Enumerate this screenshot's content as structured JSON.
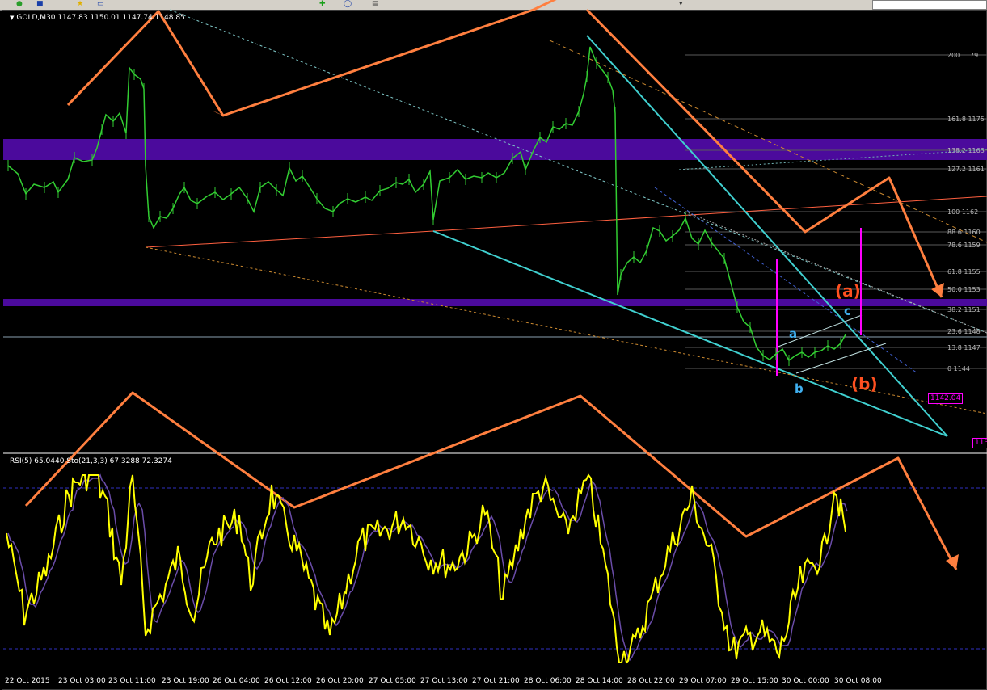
{
  "symbol_info": "GOLD,M30 1147.83 1150.01 1147.74 1148.85",
  "indicator_info": "RSI(5) 65.0440 Sto(21,3,3) 67.3288 72.3274",
  "price_tags": [
    "1142.04",
    "113"
  ],
  "fib_levels": [
    "200 1179",
    "161.8 1175",
    "138.2 1163",
    "127.2 1161",
    "100 1162",
    "88.6 1160",
    "78.6 1159",
    "61.8 1155",
    "50.0 1153",
    "38.2 1151",
    "23.6 1148",
    "13.8 1147",
    "0 1144"
  ],
  "wave_labels": {
    "a_big": "(a)",
    "b_big": "(b)",
    "a": "a",
    "b": "b",
    "c": "c"
  },
  "time_axis": [
    "22 Oct 2015",
    "23 Oct 03:00",
    "23 Oct 11:00",
    "23 Oct 19:00",
    "26 Oct 04:00",
    "26 Oct 12:00",
    "26 Oct 20:00",
    "27 Oct 05:00",
    "27 Oct 13:00",
    "27 Oct 21:00",
    "28 Oct 06:00",
    "28 Oct 14:00",
    "28 Oct 22:00",
    "29 Oct 07:00",
    "29 Oct 15:00",
    "30 Oct 00:00",
    "30 Oct 08:00"
  ],
  "colors": {
    "price": "#32cd32",
    "rsi": "#ffff00",
    "stoch": "#6a4ca8",
    "zone": "#4b0a9c",
    "arrow": "#ff7f3f",
    "channel": "#40d0d0",
    "magenta": "#ff00ff"
  }
}
